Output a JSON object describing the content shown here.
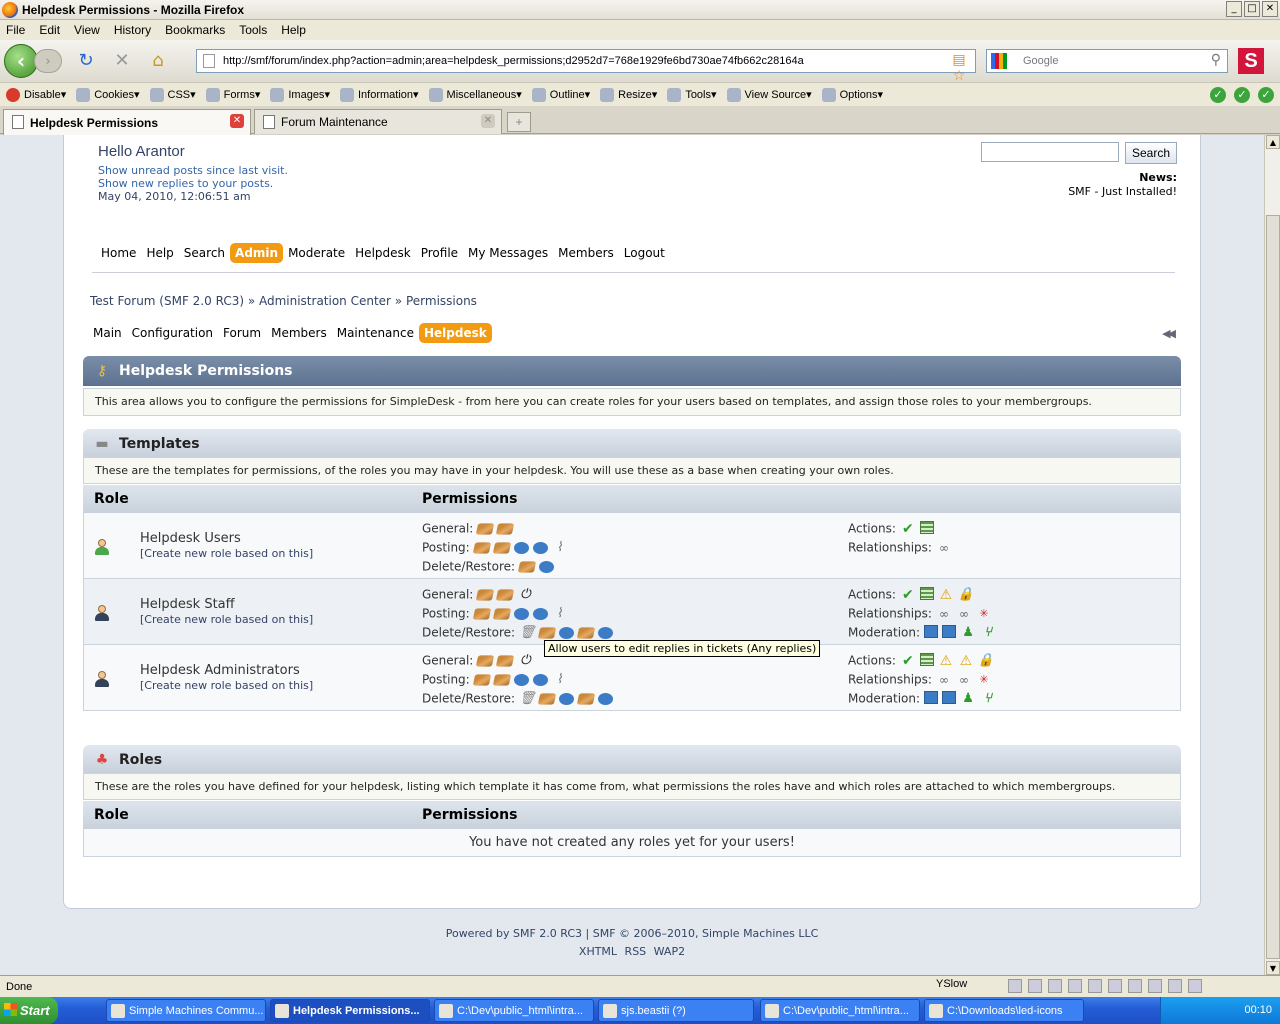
{
  "window": {
    "title": "Helpdesk Permissions - Mozilla Firefox",
    "min": "_",
    "max": "□",
    "close": "✕"
  },
  "menu": [
    "File",
    "Edit",
    "View",
    "History",
    "Bookmarks",
    "Tools",
    "Help"
  ],
  "nav": {
    "url": "http://smf/forum/index.php?action=admin;area=helpdesk_permissions;d2952d7=768e1929fe6bd730ae74fb662c28164a",
    "search_placeholder": "Google",
    "brand": "S"
  },
  "devbar": [
    "Disable",
    "Cookies",
    "CSS",
    "Forms",
    "Images",
    "Information",
    "Miscellaneous",
    "Outline",
    "Resize",
    "Tools",
    "View Source",
    "Options"
  ],
  "tabs": [
    {
      "label": "Helpdesk Permissions"
    },
    {
      "label": "Forum Maintenance"
    }
  ],
  "header": {
    "hello": "Hello Arantor",
    "unread": "Show unread posts since last visit.",
    "replies": "Show new replies to your posts.",
    "date": "May 04, 2010, 12:06:51 am",
    "search_btn": "Search",
    "news_label": "News:",
    "news_text": "SMF - Just Installed!"
  },
  "main_menu": [
    "Home",
    "Help",
    "Search",
    "Admin",
    "Moderate",
    "Helpdesk",
    "Profile",
    "My Messages",
    "Members",
    "Logout"
  ],
  "breadcrumb": "Test Forum (SMF 2.0 RC3) » Administration Center » Permissions",
  "sub_menu": [
    "Main",
    "Configuration",
    "Forum",
    "Members",
    "Maintenance",
    "Helpdesk"
  ],
  "permissions": {
    "title": "Helpdesk Permissions",
    "desc": "This area allows you to configure the permissions for SimpleDesk - from here you can create roles for your users based on templates, and assign those roles to your membergroups."
  },
  "templates": {
    "title": "Templates",
    "desc": "These are the templates for permissions, of the roles you may have in your helpdesk. You will use these as a base when creating your own roles.",
    "col_role": "Role",
    "col_perms": "Permissions",
    "create_link": "[Create new role based on this]",
    "labels": {
      "general": "General:",
      "posting": "Posting:",
      "delete": "Delete/Restore:",
      "actions": "Actions:",
      "relationships": "Relationships:",
      "moderation": "Moderation:"
    },
    "rows": [
      {
        "name": "Helpdesk Users"
      },
      {
        "name": "Helpdesk Staff"
      },
      {
        "name": "Helpdesk Administrators"
      }
    ],
    "tooltip": "Allow users to edit replies in tickets (Any replies)"
  },
  "roles": {
    "title": "Roles",
    "desc": "These are the roles you have defined for your helpdesk, listing which template it has come from, what permissions the roles have and which roles are attached to which membergroups.",
    "col_role": "Role",
    "col_perms": "Permissions",
    "empty": "You have not created any roles yet for your users!"
  },
  "footer": {
    "line1": "Powered by SMF 2.0 RC3 | SMF © 2006–2010, Simple Machines LLC",
    "line2": "XHTML   RSS   WAP2"
  },
  "status": {
    "text": "Done",
    "yslow": "YSlow"
  },
  "taskbar": {
    "start": "Start",
    "items": [
      "Simple Machines Commu...",
      "Helpdesk Permissions...",
      "C:\\Dev\\public_html\\intra...",
      "sjs.beastii (?)",
      "C:\\Dev\\public_html\\intra...",
      "C:\\Downloads\\led-icons"
    ],
    "clock": "00:10"
  }
}
